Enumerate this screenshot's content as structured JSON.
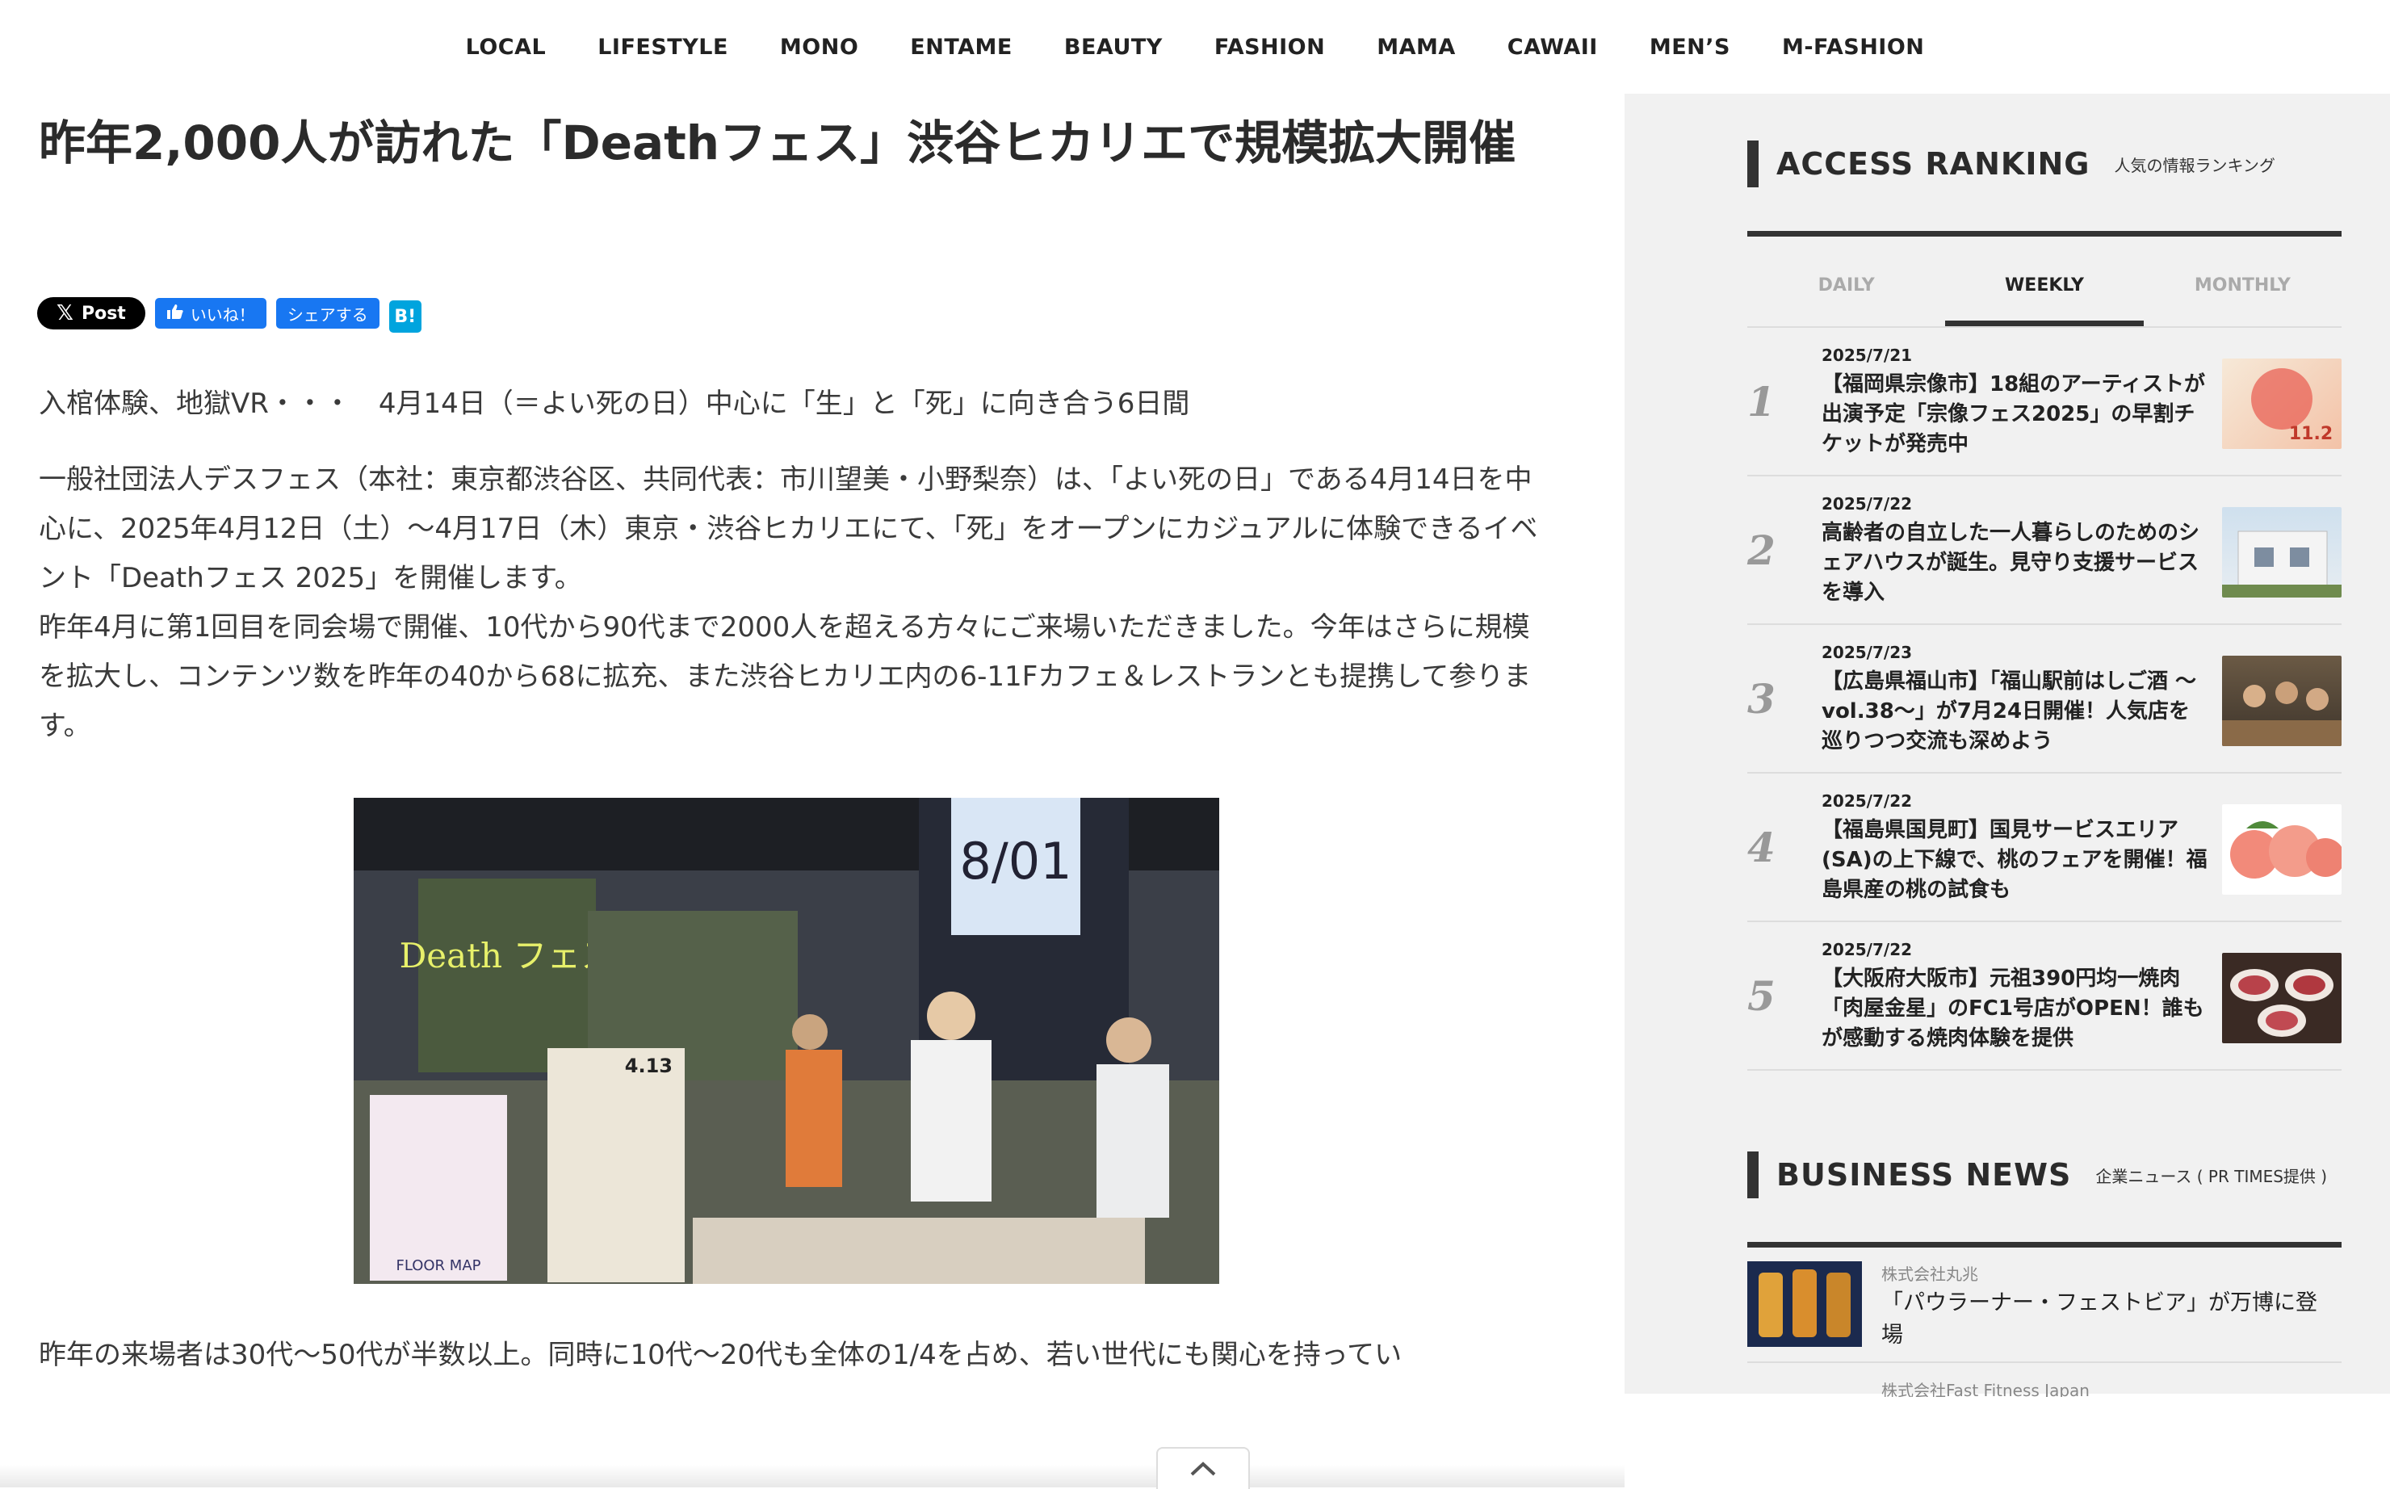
{
  "nav": [
    "LOCAL",
    "LIFESTYLE",
    "MONO",
    "ENTAME",
    "BEAUTY",
    "FASHION",
    "MAMA",
    "CAWAII",
    "MEN’S",
    "M-FASHION"
  ],
  "article": {
    "title": "昨年2,000人が訪れた「Deathフェス」渋谷ヒカリエで規模拡大開催",
    "share": {
      "x": "Post",
      "fb_like": "いいね！",
      "fb_share": "シェアする",
      "hatena": "B!"
    },
    "lead": "入棺体験、地獄VR・・・　4月14日（＝よい死の日）中心に「生」と「死」に向き合う6日間",
    "para1": "一般社団法人デスフェス（本社：東京都渋谷区、共同代表：市川望美・小野梨奈）は、「よい死の日」である4月14日を中心に、2025年4月12日（土）〜4月17日（木）東京・渋谷ヒカリエにて、「死」をオープンにカジュアルに体験できるイベント「Deathフェス 2025」を開催します。",
    "para2": "昨年4月に第1回目を同会場で開催、10代から90代まで2000人を超える方々にご来場いただきました。今年はさらに規模を拡大し、コンテンツ数を昨年の40から68に拡充、また渋谷ヒカリエ内の6-11Fカフェ＆レストランとも提携して参ります。",
    "photo": {
      "sign_text": "8/01",
      "poster_text": "Death フェス",
      "board_text": "4.13",
      "floor_text": "FLOOR MAP"
    },
    "tail": "昨年の来場者は30代〜50代が半数以上。同時に10代〜20代も全体の1/4を占め、若い世代にも関心を持ってい"
  },
  "sidebar": {
    "ranking": {
      "heading": "ACCESS RANKING",
      "sub": "人気の情報ランキング",
      "tabs": [
        "DAILY",
        "WEEKLY",
        "MONTHLY"
      ],
      "active_tab": "WEEKLY",
      "items": [
        {
          "rank": "1",
          "date": "2025/7/21",
          "title": "【福岡県宗像市】18組のアーティストが出演予定「宗像フェス2025」の早割チケットが発売中",
          "thumb_text": "11.2"
        },
        {
          "rank": "2",
          "date": "2025/7/22",
          "title": "高齢者の自立した一人暮らしのためのシェアハウスが誕生。見守り支援サービスを導入",
          "thumb_text": ""
        },
        {
          "rank": "3",
          "date": "2025/7/23",
          "title": "【広島県福山市】「福山駅前はしご酒 〜vol.38〜」が7月24日開催！人気店を巡りつつ交流も深めよう",
          "thumb_text": ""
        },
        {
          "rank": "4",
          "date": "2025/7/22",
          "title": "【福島県国見町】国見サービスエリア(SA)の上下線で、桃のフェアを開催！福島県産の桃の試食も",
          "thumb_text": ""
        },
        {
          "rank": "5",
          "date": "2025/7/22",
          "title": "【大阪府大阪市】元祖390円均一焼肉「肉屋金星」のFC1号店がOPEN！誰もが感動する焼肉体験を提供",
          "thumb_text": ""
        }
      ]
    },
    "business": {
      "heading": "BUSINESS NEWS",
      "sub": "企業ニュース ( PR TIMES提供 )",
      "items": [
        {
          "company": "株式会社丸兆",
          "title": "「パウラーナー・フェストビア」が万博に登場"
        },
        {
          "company": "株式会社Fast Fitness Japan",
          "title": ""
        }
      ]
    }
  },
  "icons": {
    "scroll_top": "chevron-up-icon"
  },
  "colors": {
    "fb_blue": "#1877f2",
    "hatena_blue": "#00a4de",
    "sidebar_bg": "#f1f1f1"
  }
}
